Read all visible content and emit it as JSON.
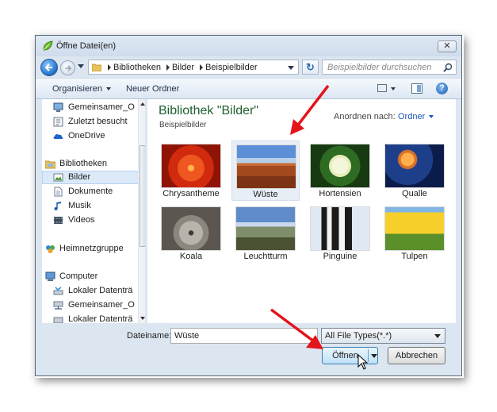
{
  "window": {
    "title": "Öffne Datei(en)",
    "close_glyph": "✕"
  },
  "address": {
    "crumbs": [
      "Bibliotheken",
      "Bilder",
      "Beispielbilder"
    ]
  },
  "search": {
    "placeholder": "Beispielbilder durchsuchen"
  },
  "toolbar": {
    "organize_label": "Organisieren",
    "new_folder_label": "Neuer Ordner",
    "help_glyph": "?"
  },
  "nav": {
    "items": [
      {
        "label": "Gemeinsamer_O",
        "icon": "network-computer-icon"
      },
      {
        "label": "Zuletzt besucht",
        "icon": "recent-places-icon"
      },
      {
        "label": "OneDrive",
        "icon": "onedrive-icon"
      },
      {
        "label": "Bibliotheken",
        "icon": "libraries-icon"
      },
      {
        "label": "Bilder",
        "icon": "pictures-icon"
      },
      {
        "label": "Dokumente",
        "icon": "documents-icon"
      },
      {
        "label": "Musik",
        "icon": "music-icon"
      },
      {
        "label": "Videos",
        "icon": "videos-icon"
      },
      {
        "label": "Heimnetzgruppe",
        "icon": "homegroup-icon"
      },
      {
        "label": "Computer",
        "icon": "computer-icon"
      },
      {
        "label": "Lokaler Datenträ",
        "icon": "local-disk-icon"
      },
      {
        "label": "Gemeinsamer_O",
        "icon": "network-drive-icon"
      },
      {
        "label": "Lokaler Datenträ",
        "icon": "local-disk-icon"
      }
    ]
  },
  "library": {
    "title": "Bibliothek \"Bilder\"",
    "subtitle": "Beispielbilder",
    "arrange_label": "Anordnen nach:",
    "arrange_value": "Ordner"
  },
  "files": [
    {
      "name": "Chrysantheme"
    },
    {
      "name": "Wüste"
    },
    {
      "name": "Hortensien"
    },
    {
      "name": "Qualle"
    },
    {
      "name": "Koala"
    },
    {
      "name": "Leuchtturm"
    },
    {
      "name": "Pinguine"
    },
    {
      "name": "Tulpen"
    }
  ],
  "bottom": {
    "filename_label": "Dateiname:",
    "filename_value": "Wüste",
    "filter_value": "All File Types(*.*)",
    "open_label": "Öffnen",
    "cancel_label": "Abbrechen"
  },
  "colors": {
    "annotation_arrow": "#e3141c",
    "library_title": "#1e5f2e",
    "link_blue": "#1a56b5"
  }
}
